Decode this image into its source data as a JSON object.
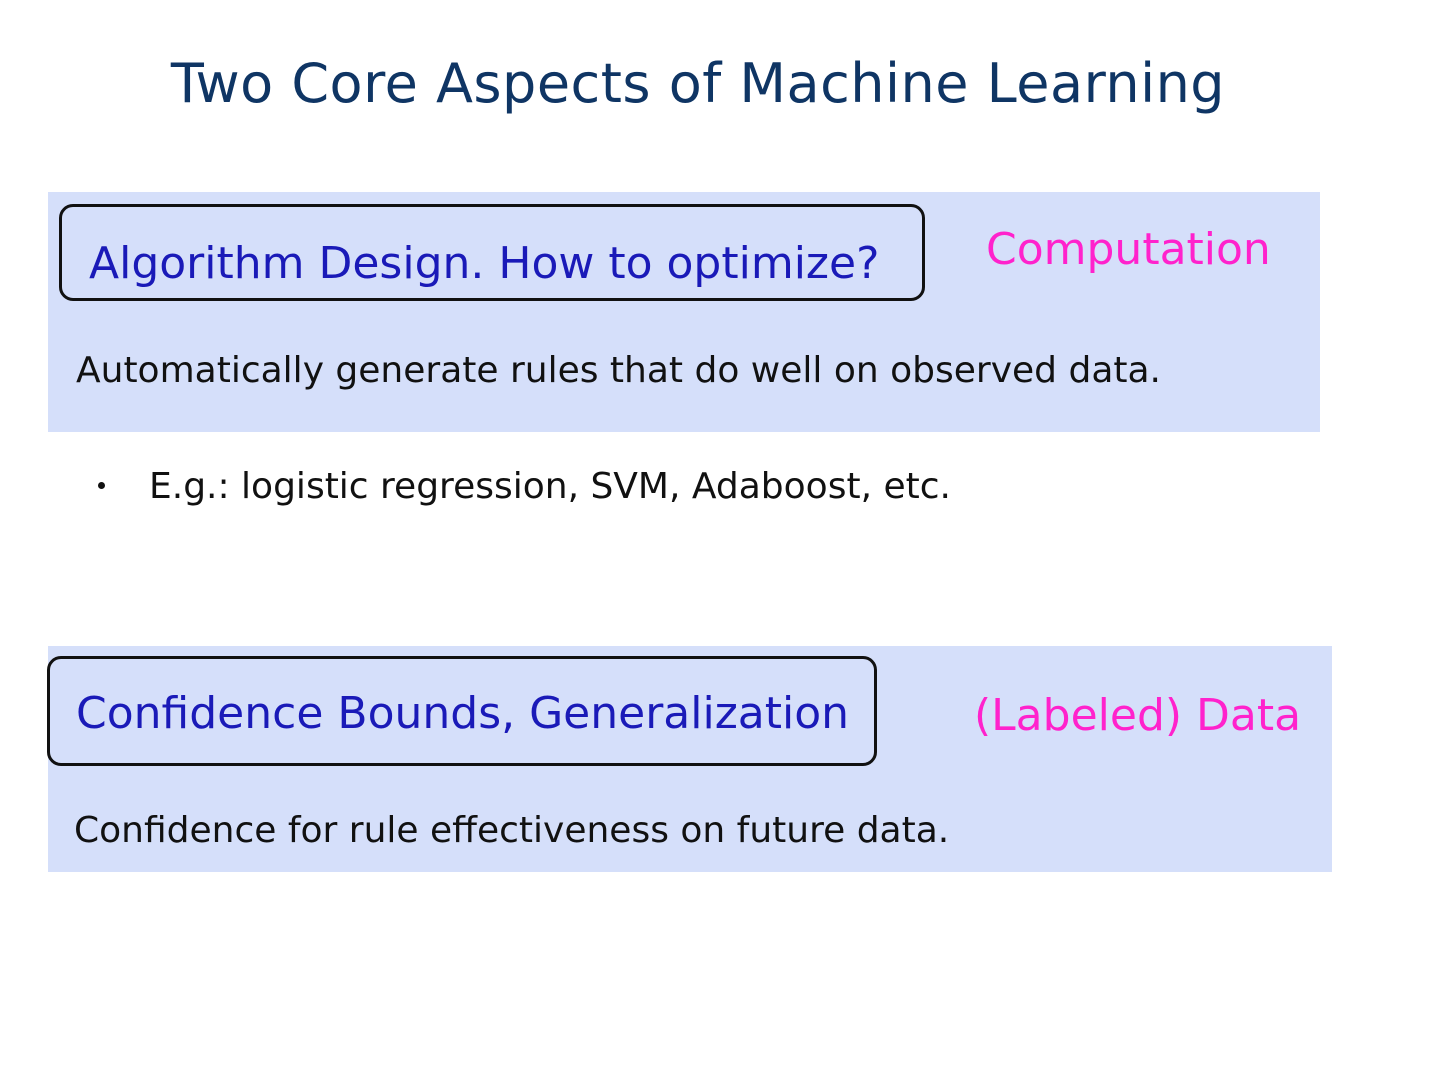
{
  "slide": {
    "title": "Two Core Aspects of Machine Learning",
    "sections": [
      {
        "heading": "Algorithm Design. How to optimize?",
        "tag": "Computation",
        "description": "Automatically generate rules that do well on observed data.",
        "bullet": "E.g.: logistic regression, SVM, Adaboost, etc."
      },
      {
        "heading": "Confidence Bounds, Generalization",
        "tag": "(Labeled) Data",
        "description": "Confidence for rule effectiveness on future data."
      }
    ]
  },
  "colors": {
    "title": "#0f3564",
    "panel_background": "#d5dffa",
    "heading_text": "#1a1ab8",
    "tag_text": "#ff22cc",
    "body_text": "#111111"
  }
}
